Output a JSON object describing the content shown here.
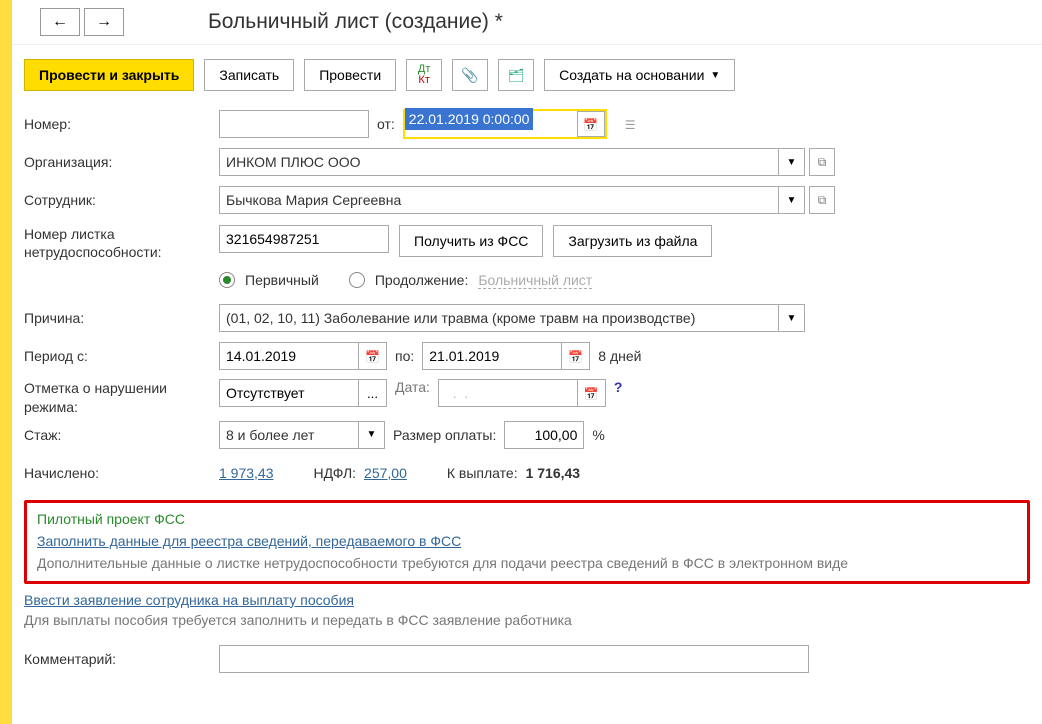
{
  "header": {
    "title": "Больничный лист (создание) *"
  },
  "toolbar": {
    "post_and_close": "Провести и закрыть",
    "save": "Записать",
    "post": "Провести",
    "create_based_on": "Создать на основании"
  },
  "form": {
    "number_label": "Номер:",
    "number_value": "",
    "from_label": "от:",
    "from_value": "22.01.2019  0:00:00",
    "org_label": "Организация:",
    "org_value": "ИНКОМ ПЛЮС ООО",
    "employee_label": "Сотрудник:",
    "employee_value": "Бычкова Мария Сергеевна",
    "sicklist_number_label": "Номер листка нетрудоспособности:",
    "sicklist_number_value": "321654987251",
    "get_from_fss": "Получить из ФСС",
    "load_from_file": "Загрузить из файла",
    "radio_primary": "Первичный",
    "radio_continuation": "Продолжение:",
    "continuation_link": "Больничный лист",
    "reason_label": "Причина:",
    "reason_value": "(01, 02, 10, 11) Заболевание или травма (кроме травм на производстве)",
    "period_from_label": "Период с:",
    "period_from_value": "14.01.2019",
    "period_to_label": "по:",
    "period_to_value": "21.01.2019",
    "period_days": "8 дней",
    "violation_label": "Отметка о нарушении режима:",
    "violation_value": "Отсутствует",
    "violation_date_label": "Дата:",
    "violation_date_value": "  .  .    ",
    "stage_label": "Стаж:",
    "stage_value": "8 и более лет",
    "payrate_label": "Размер оплаты:",
    "payrate_value": "100,00",
    "percent": "%",
    "accrued_label": "Начислено:",
    "accrued_value": "1 973,43",
    "ndfl_label": "НДФЛ:",
    "ndfl_value": "257,00",
    "payout_label": "К выплате:",
    "payout_value": "1 716,43"
  },
  "fss": {
    "title": "Пилотный проект ФСС",
    "fill_link": "Заполнить данные для реестра сведений, передаваемого в ФСС",
    "note": "Дополнительные данные о листке нетрудоспособности требуются для подачи реестра сведений в ФСС в электронном виде"
  },
  "application": {
    "link": "Ввести заявление сотрудника на выплату пособия",
    "note": "Для выплаты пособия требуется заполнить и передать в ФСС заявление работника"
  },
  "comment_label": "Комментарий:",
  "comment_value": ""
}
